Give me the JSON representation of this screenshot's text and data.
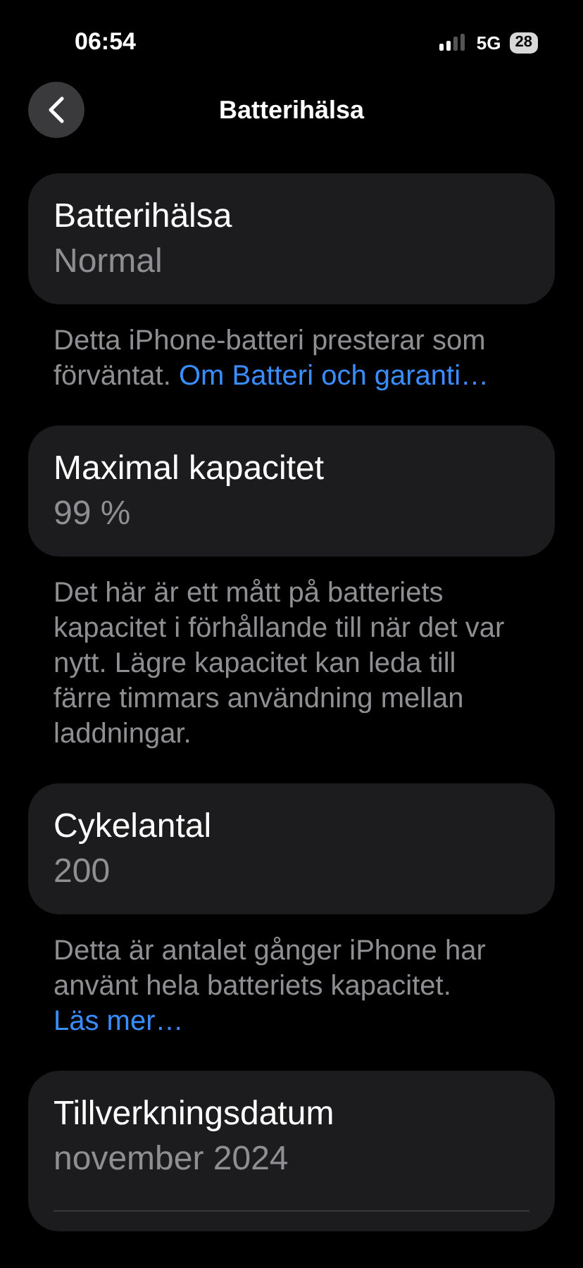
{
  "status_bar": {
    "time": "06:54",
    "network": "5G",
    "battery": "28"
  },
  "nav": {
    "title": "Batterihälsa"
  },
  "sections": [
    {
      "title": "Batterihälsa",
      "value": "Normal",
      "footer": {
        "text": "Detta iPhone-batteri presterar som förväntat.",
        "link": "Om Batteri och garanti…"
      }
    },
    {
      "title": "Maximal kapacitet",
      "value": "99 %",
      "footer": {
        "text": "Det här är ett mått på batteriets kapacitet i förhållande till när det var nytt. Lägre kapacitet kan leda till färre timmars användning mellan laddningar."
      }
    },
    {
      "title": "Cykelantal",
      "value": "200",
      "footer": {
        "text": "Detta är antalet gånger iPhone har använt hela batteriets kapacitet.",
        "link": "Läs mer…"
      }
    },
    {
      "title": "Tillverkningsdatum",
      "value": "november 2024"
    }
  ]
}
